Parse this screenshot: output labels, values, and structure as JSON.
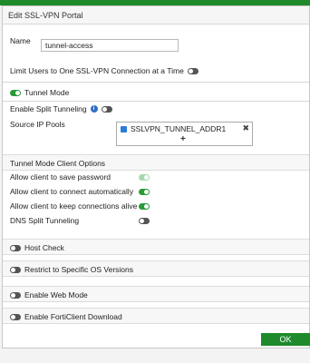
{
  "dialog": {
    "title": "Edit SSL-VPN Portal"
  },
  "name_field": {
    "label": "Name",
    "value": "tunnel-access"
  },
  "limit_users": {
    "label": "Limit Users to One SSL-VPN Connection at a Time",
    "enabled": false
  },
  "tunnel_mode": {
    "label": "Tunnel Mode",
    "enabled": true,
    "split_tunneling": {
      "label": "Enable Split Tunneling",
      "enabled": false,
      "info_icon": "info-icon"
    },
    "source_ip_pools": {
      "label": "Source IP Pools",
      "items": [
        "SSLVPN_TUNNEL_ADDR1"
      ],
      "add_symbol": "+",
      "remove_symbol": "✖"
    }
  },
  "client_options": {
    "title": "Tunnel Mode Client Options",
    "items": [
      {
        "label": "Allow client to save password",
        "enabled": true,
        "disabled": true
      },
      {
        "label": "Allow client to connect automatically",
        "enabled": true,
        "disabled": false
      },
      {
        "label": "Allow client to keep connections alive",
        "enabled": true,
        "disabled": false
      },
      {
        "label": "DNS Split Tunneling",
        "enabled": false,
        "disabled": false
      }
    ]
  },
  "sections": {
    "host_check": {
      "label": "Host Check",
      "enabled": false
    },
    "restrict_os": {
      "label": "Restrict to Specific OS Versions",
      "enabled": false
    },
    "web_mode": {
      "label": "Enable Web Mode",
      "enabled": false
    },
    "forticlient_download": {
      "label": "Enable FortiClient Download",
      "enabled": false
    }
  },
  "footer": {
    "ok_label": "OK"
  },
  "colors": {
    "accent": "#1e8a2c",
    "toggle_off": "#555555",
    "info": "#2f6fc4"
  }
}
